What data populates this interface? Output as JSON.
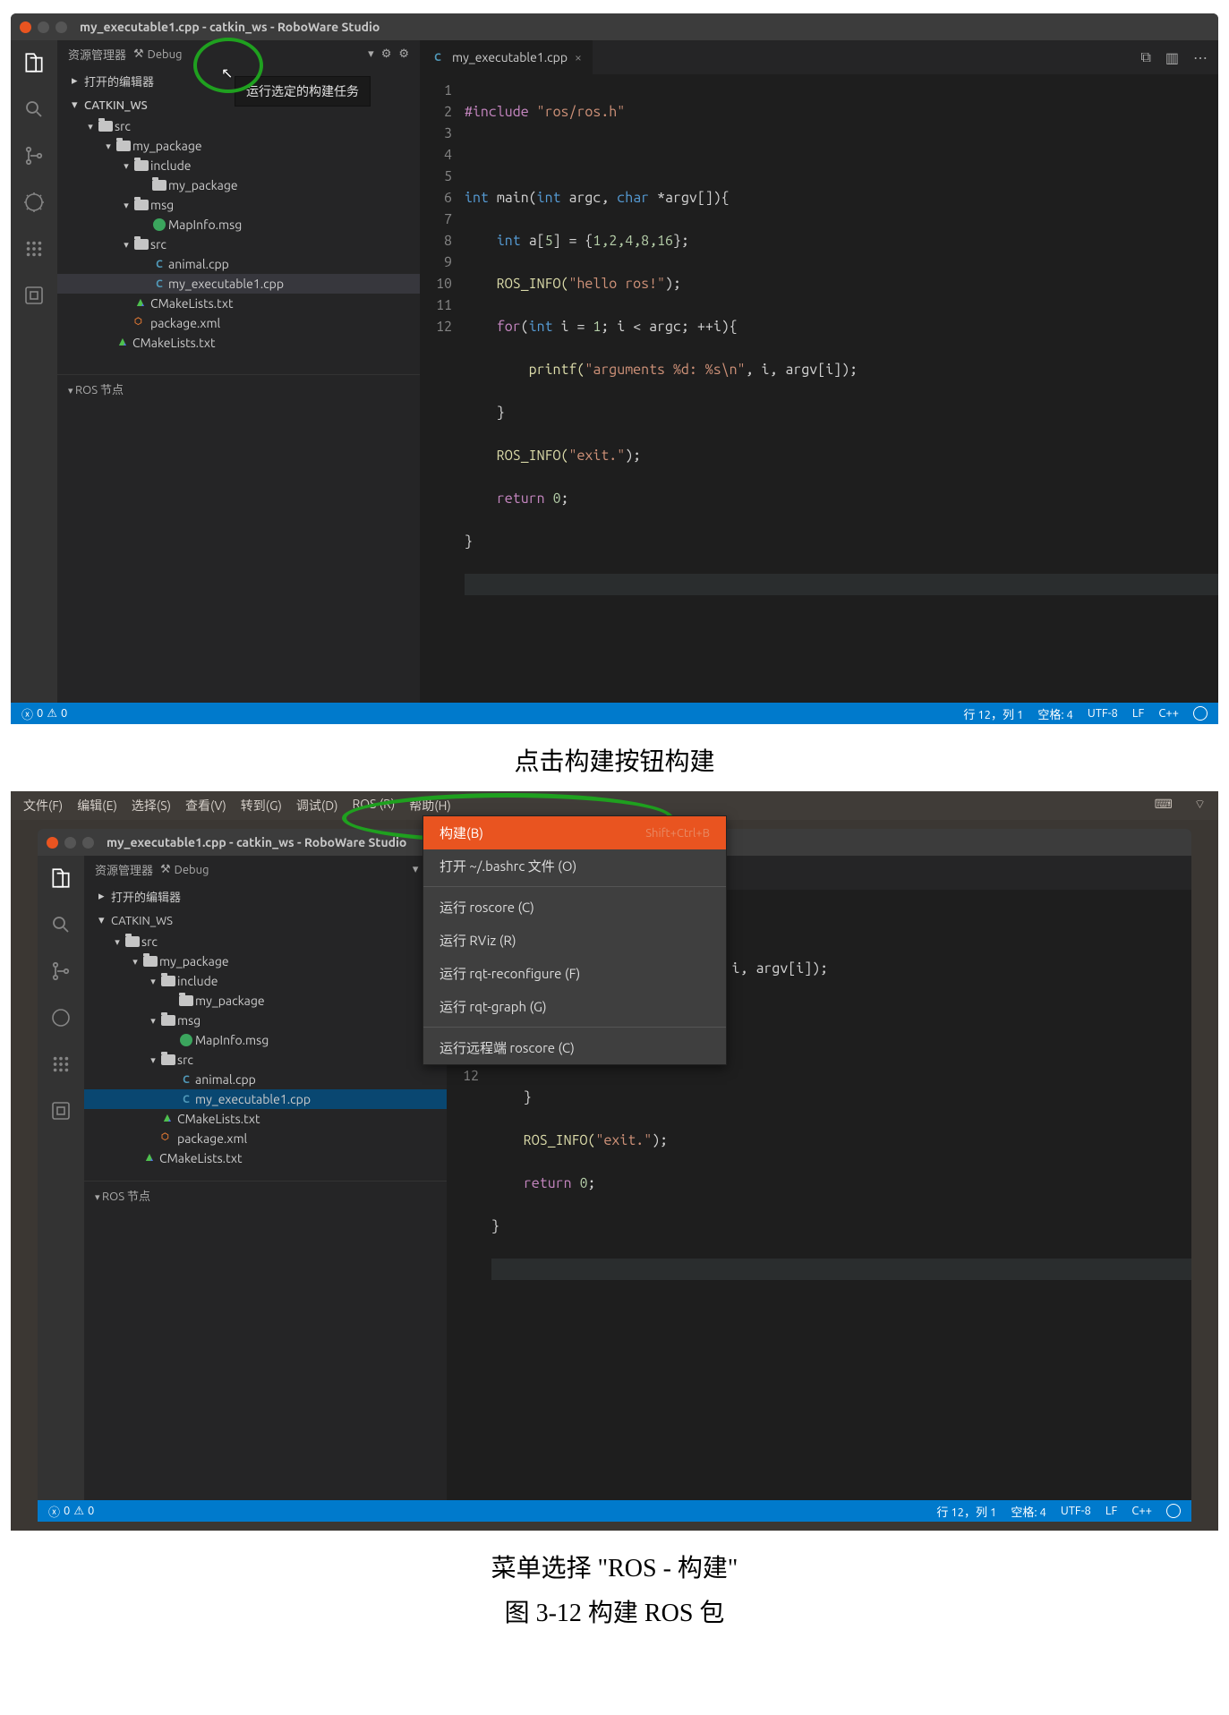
{
  "caption_build": "点击构建按钮构建",
  "caption_menu": "菜单选择 \"ROS - 构建\"",
  "figure_label": "图 3-12 构建 ROS 包",
  "ide": {
    "window_title": "my_executable1.cpp - catkin_ws - RoboWare Studio",
    "explorer_label": "资源管理器",
    "build_config": "Debug",
    "build_tooltip": "运行选定的构建任务",
    "opened_editors": "打开的编辑器",
    "workspace": "CATKIN_WS",
    "ros_nodes": "ROS 节点",
    "tree": {
      "src": "src",
      "my_package": "my_package",
      "include": "include",
      "include_my_package": "my_package",
      "msg": "msg",
      "mapinfo": "MapInfo.msg",
      "src2": "src",
      "animal": "animal.cpp",
      "my_exec": "my_executable1.cpp",
      "cmake_pkg": "CMakeLists.txt",
      "package_xml": "package.xml",
      "cmake_root": "CMakeLists.txt"
    },
    "tab": {
      "name": "my_executable1.cpp"
    },
    "code": {
      "l1": "#include \"ros/ros.h\"",
      "l3a": "int",
      "l3b": " main(",
      "l3c": "int",
      "l3d": " argc, ",
      "l3e": "char",
      "l3f": " *argv[]){",
      "l4a": "    int",
      "l4b": " a[",
      "l4c": "5",
      "l4d": "] = {",
      "l4e": "1,2,4,8,16",
      "l4f": "};",
      "l5a": "    ROS_INFO(",
      "l5b": "\"hello ros!\"",
      "l5c": ");",
      "l6a": "    for",
      "l6b": "(",
      "l6c": "int",
      "l6d": " i = ",
      "l6e": "1",
      "l6f": "; i < argc; ++i){",
      "l7a": "        printf(",
      "l7b": "\"arguments %d: %s\\n\"",
      "l7c": ", i, argv[i]);",
      "l8": "    }",
      "l9a": "    ROS_INFO(",
      "l9b": "\"exit.\"",
      "l9c": ");",
      "l10a": "    return ",
      "l10b": "0",
      "l10c": ";",
      "l11": "}"
    },
    "status": {
      "errors": "0",
      "warnings": "0",
      "line_col": "行 12，列 1",
      "spaces": "空格: 4",
      "encoding": "UTF-8",
      "eol": "LF",
      "lang": "C++"
    }
  },
  "menubar": {
    "file": "文件(F)",
    "edit": "编辑(E)",
    "select": "选择(S)",
    "view": "查看(V)",
    "goto": "转到(G)",
    "debug": "调试(D)",
    "ros": "ROS (R)",
    "help": "帮助(H)"
  },
  "ros_menu": {
    "build": "构建(B)",
    "build_shortcut": "Shift+Ctrl+B",
    "open_bashrc": "打开 ~/.bashrc 文件 (O)",
    "run_roscore": "运行 roscore (C)",
    "run_rviz": "运行 RViz (R)",
    "run_rqt_reconf": "运行 rqt-reconfigure (F)",
    "run_rqt_graph": "运行 rqt-graph (G)",
    "run_remote_roscore": "运行远程端 roscore (C)"
  }
}
